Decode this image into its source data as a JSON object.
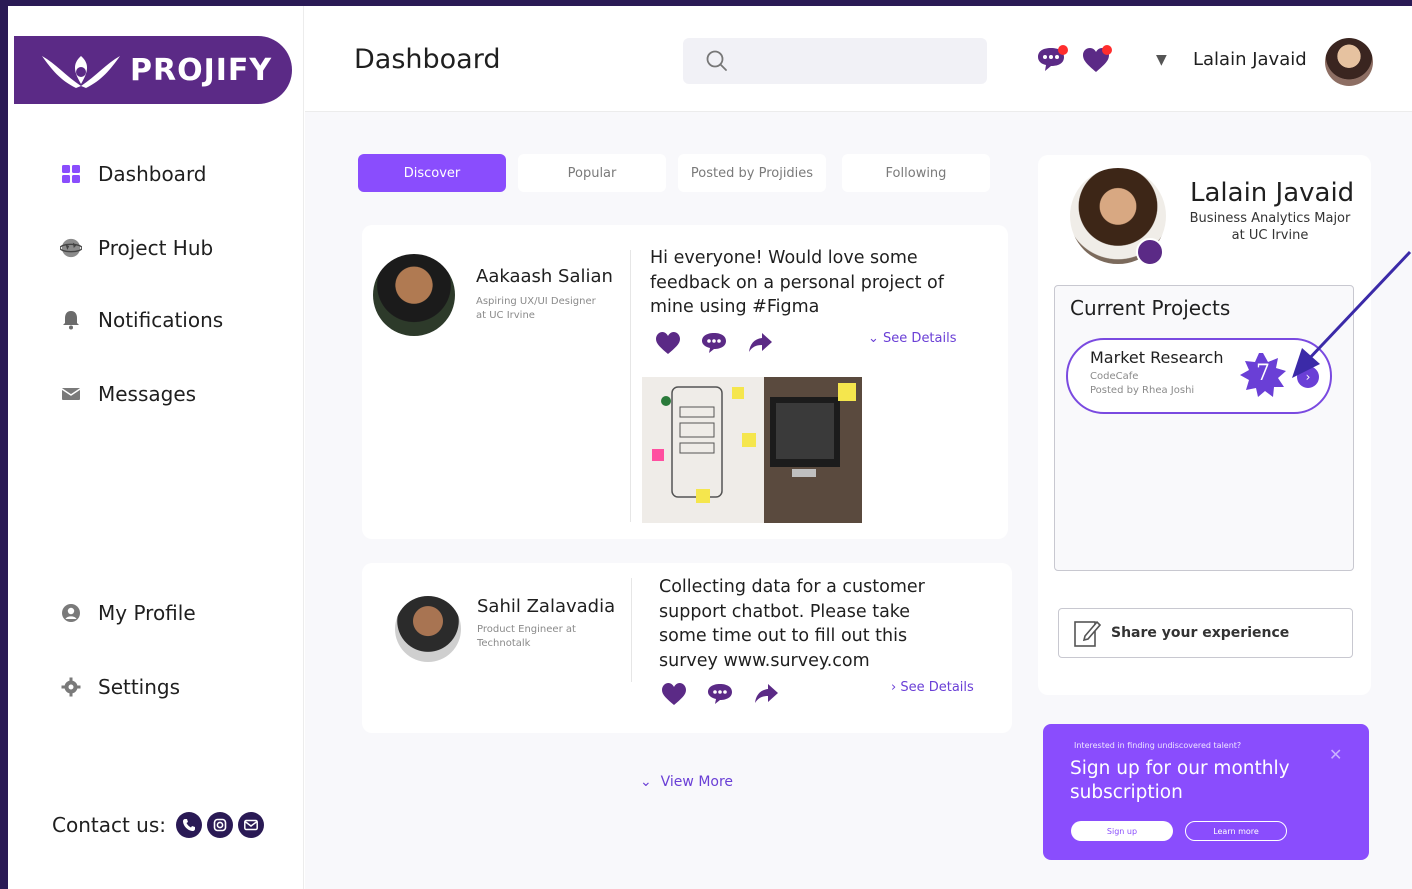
{
  "app": {
    "logo_text": "PROJIFY"
  },
  "sidebar": {
    "items": [
      {
        "label": "Dashboard",
        "icon": "grid-icon"
      },
      {
        "label": "Project Hub",
        "icon": "globe-icon"
      },
      {
        "label": "Notifications",
        "icon": "bell-icon"
      },
      {
        "label": "Messages",
        "icon": "envelope-icon"
      },
      {
        "label": "My Profile",
        "icon": "user-circle-icon"
      },
      {
        "label": "Settings",
        "icon": "gear-icon"
      }
    ],
    "contact_label": "Contact us:",
    "contact_icons": [
      "phone-icon",
      "instagram-icon",
      "email-icon"
    ]
  },
  "header": {
    "title": "Dashboard",
    "search_placeholder": "",
    "user_name": "Lalain Javaid",
    "icons": [
      "chat-notification-icon",
      "heart-notification-icon",
      "dropdown-caret-icon"
    ]
  },
  "tabs": [
    {
      "label": "Discover",
      "active": true
    },
    {
      "label": "Popular",
      "active": false
    },
    {
      "label": "Posted by Projidies",
      "active": false
    },
    {
      "label": "Following",
      "active": false
    }
  ],
  "posts": [
    {
      "author": "Aakaash Salian",
      "role": "Aspiring UX/UI Designer at UC Irvine",
      "text_lines": [
        "Hi everyone! Would love some",
        "feedback on a personal project of",
        "mine using #Figma"
      ],
      "see_details": "See Details"
    },
    {
      "author": "Sahil Zalavadia",
      "role": "Product Engineer at Technotalk",
      "text_lines": [
        "Collecting data for a customer",
        "support chatbot. Please take",
        "some time out to fill out this",
        "survey www.survey.com"
      ],
      "see_details": "See Details"
    }
  ],
  "view_more": "View More",
  "profile": {
    "name": "Lalain Javaid",
    "major_lines": [
      "Business Analytics Major",
      "at UC Irvine"
    ]
  },
  "current_projects": {
    "title": "Current Projects",
    "items": [
      {
        "name": "Market Research",
        "org": "CodeCafe",
        "posted_by": "Posted by Rhea Joshi",
        "badge_count": "7"
      }
    ]
  },
  "share": {
    "label": "Share your experience"
  },
  "promo": {
    "small_text": "Interested in finding undiscovered talent?",
    "title_lines": [
      "Sign up for our monthly",
      "subscription"
    ],
    "signup_label": "Sign up",
    "learn_label": "Learn more",
    "close_glyph": "✕"
  },
  "colors": {
    "brand_dark": "#5b2a86",
    "accent": "#8a4dfd",
    "link": "#6a3fd6",
    "frame": "#2a1a55"
  }
}
